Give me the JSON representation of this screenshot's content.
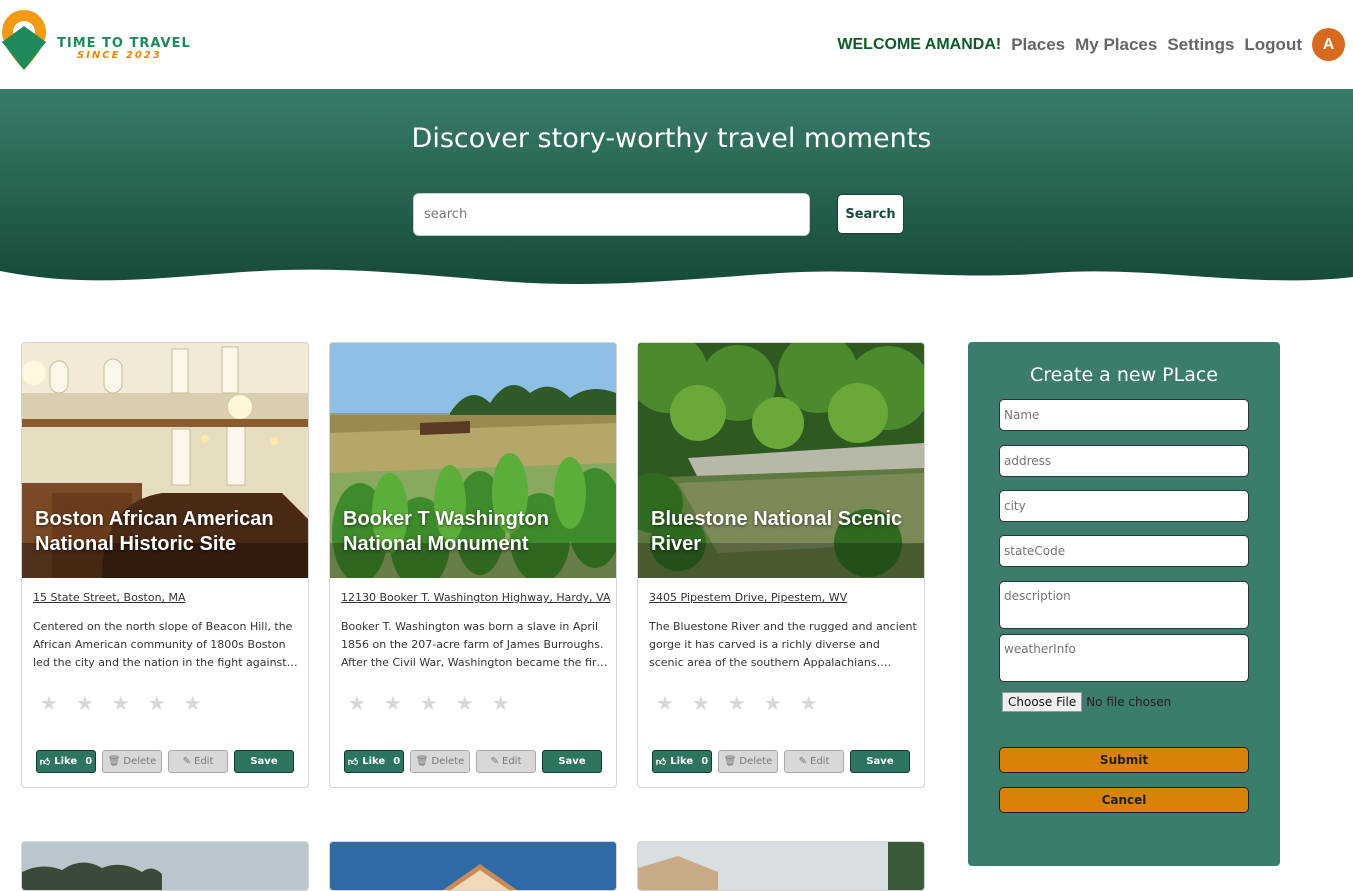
{
  "brand": {
    "title": "TIME TO TRAVEL",
    "subtitle": "SINCE 2023"
  },
  "nav": {
    "welcome": "WELCOME AMANDA!",
    "links": [
      "Places",
      "My Places",
      "Settings",
      "Logout"
    ],
    "avatar_letter": "A"
  },
  "hero": {
    "title": "Discover story-worthy travel moments",
    "search_placeholder": "search",
    "search_button": "Search"
  },
  "cards": [
    {
      "title": "Boston African American National Historic Site",
      "address": "15 State Street, Boston, MA",
      "description": "Centered on the north slope of Beacon Hill, the African American community of 1800s Boston led the city and the nation in the fight against slavery and injustice.",
      "like_label": "Like",
      "like_count": "0",
      "delete_label": "Delete",
      "edit_label": "Edit",
      "save_label": "Save"
    },
    {
      "title": "Booker T Washington National Monument",
      "address": "12130 Booker T. Washington Highway, Hardy, VA",
      "description": "Booker T. Washington was born a slave in April 1856 on the 207-acre farm of James Burroughs. After the Civil War, Washington became the first principal of Tuskegee.",
      "like_label": "Like",
      "like_count": "0",
      "delete_label": "Delete",
      "edit_label": "Edit",
      "save_label": "Save"
    },
    {
      "title": "Bluestone National Scenic River",
      "address": "3405 Pipestem Drive, Pipestem, WV",
      "description": "The Bluestone River and the rugged and ancient gorge it has carved is a richly diverse and scenic area of the southern Appalachians. Bluestone National Scenic River.",
      "like_label": "Like",
      "like_count": "0",
      "delete_label": "Delete",
      "edit_label": "Edit",
      "save_label": "Save"
    }
  ],
  "form": {
    "title": "Create a new PLace",
    "name_placeholder": "Name",
    "address_placeholder": "address",
    "city_placeholder": "city",
    "state_placeholder": "stateCode",
    "description_placeholder": "description",
    "weather_placeholder": "weatherInfo",
    "file_button": "Choose File",
    "file_status": "No file chosen",
    "submit_label": "Submit",
    "cancel_label": "Cancel"
  },
  "colors": {
    "primary_green": "#2d7560",
    "hero_green": "#1f5e4c",
    "panel_green": "#3b7c6c",
    "accent_orange": "#d98208",
    "welcome_green": "#0e5a2a"
  },
  "icons": [
    "thumbs-up-icon",
    "trash-icon",
    "edit-icon",
    "star-icon",
    "logo-pin-icon"
  ]
}
